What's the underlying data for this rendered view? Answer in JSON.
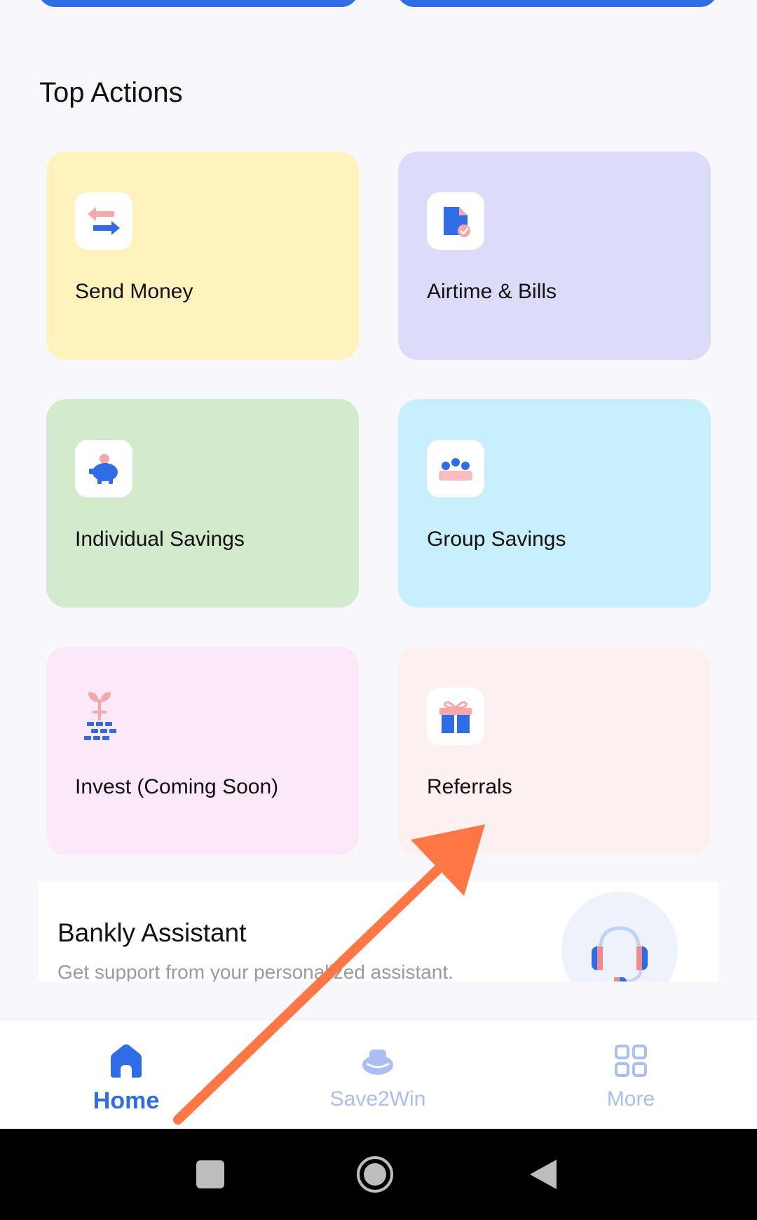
{
  "section": {
    "title": "Top Actions"
  },
  "actions": [
    {
      "label": "Send Money",
      "icon": "transfer-arrows-icon"
    },
    {
      "label": "Airtime & Bills",
      "icon": "bill-document-icon"
    },
    {
      "label": "Individual Savings",
      "icon": "piggy-bank-icon"
    },
    {
      "label": "Group Savings",
      "icon": "group-people-icon"
    },
    {
      "label": "Invest (Coming Soon)",
      "icon": "plant-growth-icon"
    },
    {
      "label": "Referrals",
      "icon": "gift-icon"
    }
  ],
  "assistant": {
    "title": "Bankly Assistant",
    "subtitle": "Get support from your personalized assistant.",
    "icon": "headset-icon"
  },
  "nav": {
    "home": "Home",
    "save2win": "Save2Win",
    "more": "More"
  },
  "colors": {
    "accent": "#2f6ce5",
    "annotation_arrow": "#ff7744"
  }
}
